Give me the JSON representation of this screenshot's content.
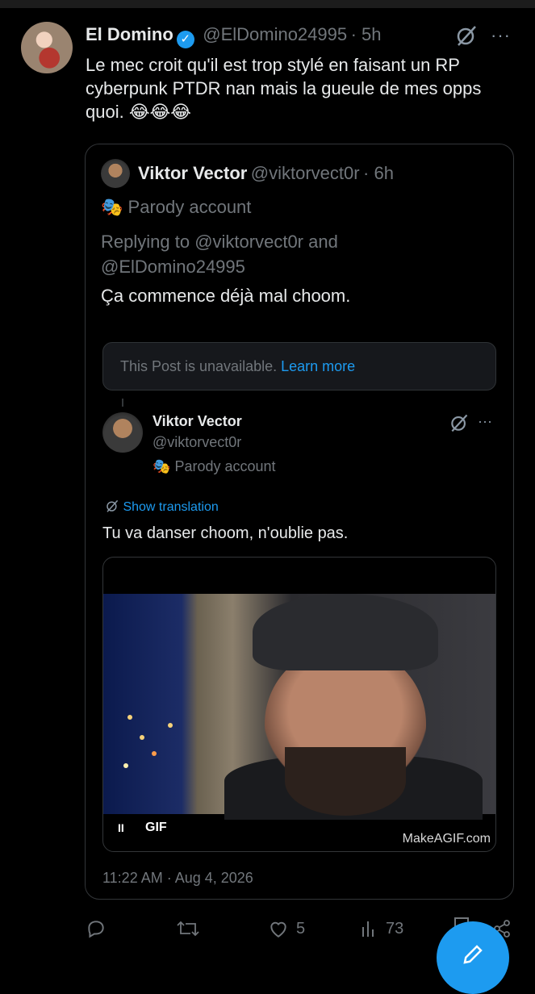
{
  "main_tweet": {
    "display_name": "El Domino",
    "handle": "@ElDomino24995",
    "time": "· 5h",
    "text": "Le mec croit qu'il est trop stylé en faisant un RP cyberpunk PTDR nan mais la gueule de mes opps quoi. 😂😂😂"
  },
  "quote": {
    "display_name": "Viktor Vector",
    "handle": "@viktorvect0r",
    "time": "· 6h",
    "parody_label": "Parody account",
    "replying_prefix": "Replying to",
    "replying_handle_1": "@viktorvect0r",
    "replying_and": "and",
    "replying_handle_2": "@ElDomino24995",
    "text": "Ça commence déjà mal choom.",
    "unavailable_text": "This Post is unavailable.",
    "learn_more": "Learn more"
  },
  "nested": {
    "display_name": "Viktor Vector",
    "handle": "@viktorvect0r",
    "parody_label": "Parody account",
    "show_translation": "Show translation",
    "text": "Tu va danser choom, n'oublie pas.",
    "gif_label": "GIF",
    "pause_symbol": "II",
    "watermark": "MakeAGIF.com",
    "timestamp": "11:22 AM · Aug 4, 2026"
  },
  "actions": {
    "likes": "5",
    "views": "73"
  },
  "colors": {
    "background": "#000000",
    "text": "#e7e9ea",
    "muted": "#71767b",
    "accent": "#1d9bf0",
    "border": "#333639"
  },
  "icons": [
    "verified-badge-icon",
    "grok-icon",
    "more-icon",
    "parody-mask-icon",
    "translate-icon",
    "pause-icon",
    "reply-icon",
    "repost-icon",
    "like-icon",
    "views-icon",
    "bookmark-icon",
    "share-icon",
    "compose-icon"
  ]
}
